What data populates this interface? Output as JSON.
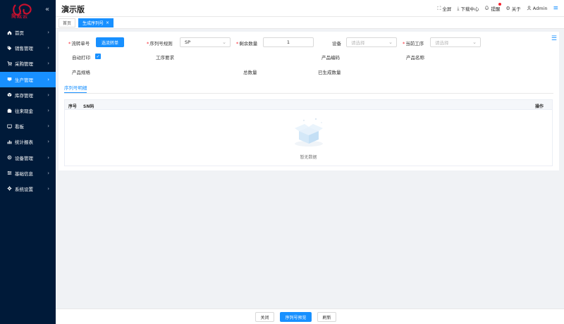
{
  "app": {
    "window_title": "演示版"
  },
  "sidebar": {
    "logo_text": "简耘云",
    "logo_sub": "JIANYUN CLOUD",
    "items": [
      {
        "label": "首页",
        "icon": "home-icon",
        "active": false
      },
      {
        "label": "销售管理",
        "icon": "tag-icon",
        "active": false
      },
      {
        "label": "采购管理",
        "icon": "cart-icon",
        "active": false
      },
      {
        "label": "生产管理",
        "icon": "monitor-icon",
        "active": true
      },
      {
        "label": "库存管理",
        "icon": "box-icon",
        "active": false
      },
      {
        "label": "往来现金",
        "icon": "wallet-icon",
        "active": false
      },
      {
        "label": "看板",
        "icon": "board-icon",
        "active": false
      },
      {
        "label": "统计报表",
        "icon": "chart-icon",
        "active": false
      },
      {
        "label": "设备管理",
        "icon": "device-icon",
        "active": false
      },
      {
        "label": "基础信息",
        "icon": "sliders-icon",
        "active": false
      },
      {
        "label": "系统设置",
        "icon": "gear-icon",
        "active": false
      }
    ]
  },
  "header": {
    "title": "演示版",
    "tools": {
      "fullscreen": "全屏",
      "download": "下载中心",
      "remind": "提醒",
      "about": "关于",
      "user": "Admin"
    }
  },
  "tabs": [
    {
      "label": "首页",
      "active": false
    },
    {
      "label": "生成序列号",
      "active": true,
      "close": "×"
    }
  ],
  "form": {
    "flow_no_label": "流转单号",
    "select_flow_button": "选流转单",
    "serial_rule_label": "序列号规则",
    "serial_rule_value": "SP",
    "remaining_qty_label": "剩余数量",
    "remaining_qty_value": "1",
    "device_label": "设备",
    "device_placeholder": "请选择",
    "current_process_label": "当前工序",
    "current_process_placeholder": "请选择",
    "auto_print_label": "自动打印",
    "auto_print_checked": true,
    "process_req_label": "工序要求",
    "product_code_label": "产品编码",
    "product_name_label": "产品名称",
    "product_spec_label": "产品规格",
    "total_qty_label": "总数量",
    "generated_qty_label": "已生成数量"
  },
  "detail": {
    "tab_label": "序列号明细",
    "columns": {
      "index": "序号",
      "sn": "SN码",
      "action": "操作"
    },
    "empty_text": "暂无数据"
  },
  "footer": {
    "close": "关闭",
    "preview": "序列号预览",
    "refresh": "刷新"
  },
  "colors": {
    "sidebar_bg": "#001a39",
    "accent": "#1890ff",
    "logo": "#c8102e"
  }
}
